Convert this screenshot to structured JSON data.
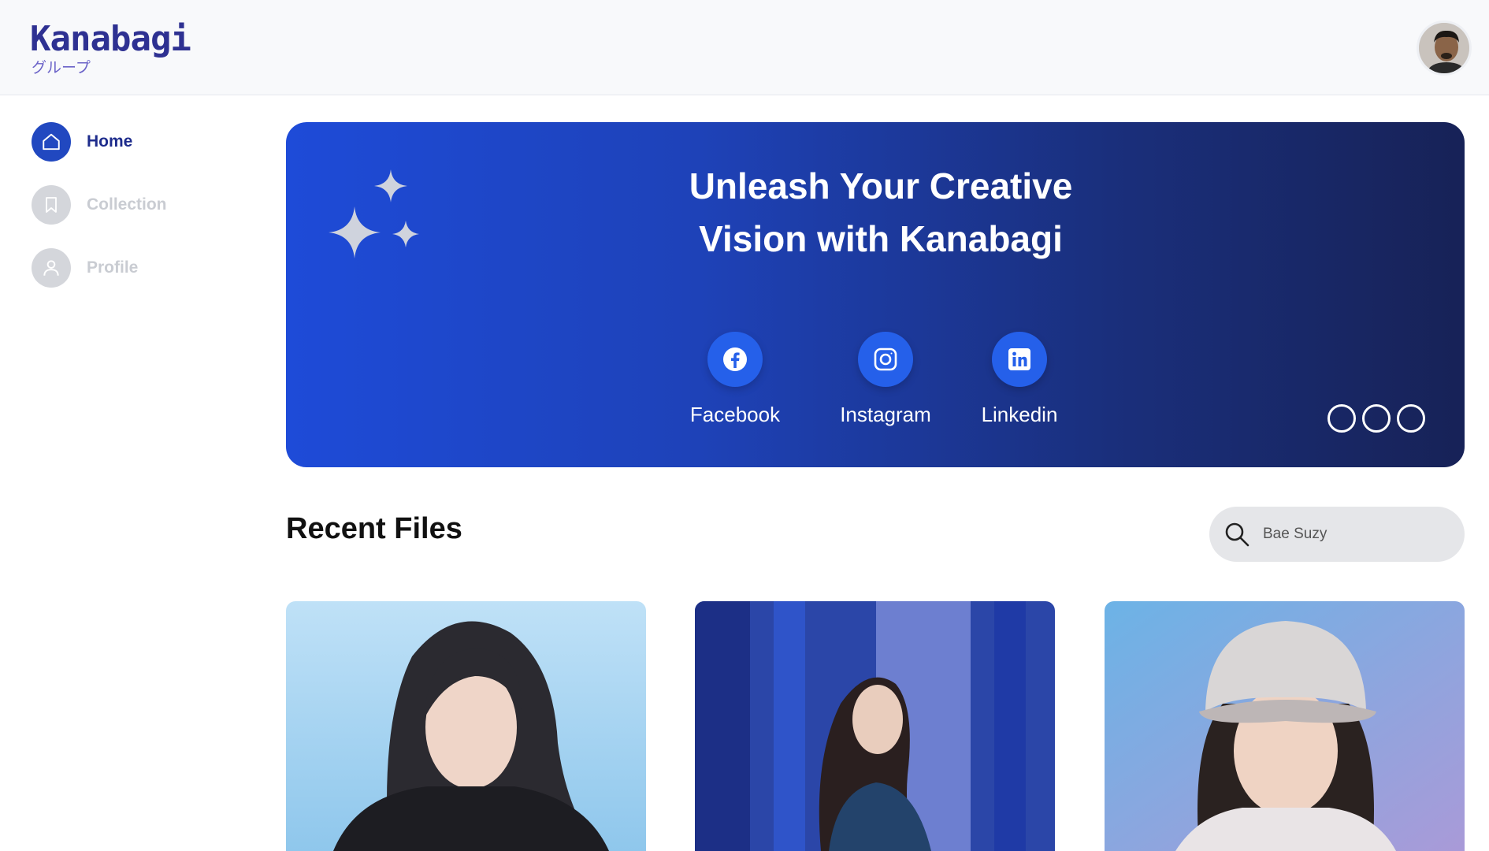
{
  "brand": {
    "name": "Kanabagi",
    "subtitle": "グループ"
  },
  "sidebar": {
    "items": [
      {
        "label": "Home",
        "icon": "home-icon",
        "active": true
      },
      {
        "label": "Collection",
        "icon": "bookmark-icon",
        "active": false
      },
      {
        "label": "Profile",
        "icon": "user-icon",
        "active": false
      }
    ]
  },
  "hero": {
    "title_line1": "Unleash Your Creative",
    "title_line2": "Vision with Kanabagi",
    "social": [
      {
        "label": "Facebook",
        "icon": "facebook-icon"
      },
      {
        "label": "Instagram",
        "icon": "instagram-icon"
      },
      {
        "label": "Linkedin",
        "icon": "linkedin-icon"
      }
    ]
  },
  "recent": {
    "title": "Recent Files",
    "search_value": "Bae Suzy"
  },
  "colors": {
    "brand": "#2e3192",
    "accent": "#2148c0",
    "hero_start": "#1e4bd8",
    "hero_end": "#172257"
  }
}
